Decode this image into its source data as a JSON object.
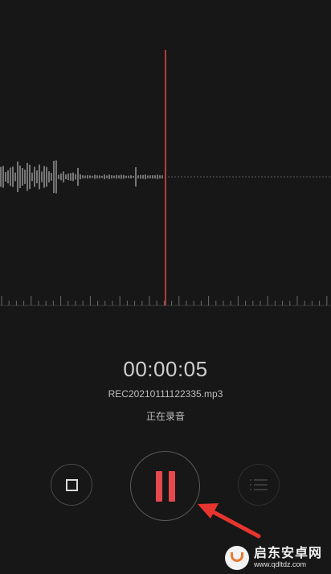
{
  "recorder": {
    "elapsed_time": "00:00:05",
    "file_name": "REC20210111122335.mp3",
    "status_text": "正在录音"
  },
  "controls": {
    "stop_icon": "stop-square-icon",
    "pause_icon": "pause-icon",
    "list_icon": "list-icon"
  },
  "colors": {
    "background": "#171717",
    "accent": "#e5484d",
    "arrow": "#e8352f"
  },
  "watermark": {
    "title": "启东安卓网",
    "url": "www.qdltdz.com"
  }
}
